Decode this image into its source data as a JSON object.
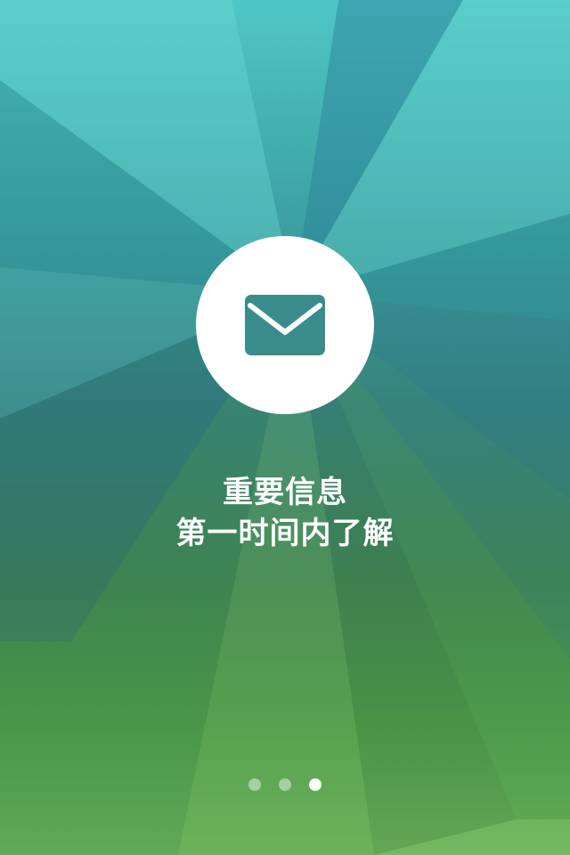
{
  "onboarding": {
    "icon": "envelope-icon",
    "title_line1": "重要信息",
    "title_line2": "第一时间内了解"
  },
  "pager": {
    "total": 3,
    "active_index": 3
  },
  "colors": {
    "circle": "#ffffff",
    "envelope": "#3a8c8c",
    "text": "#ffffff",
    "dot_inactive": "rgba(255,255,255,0.45)",
    "dot_active": "#ffffff"
  }
}
